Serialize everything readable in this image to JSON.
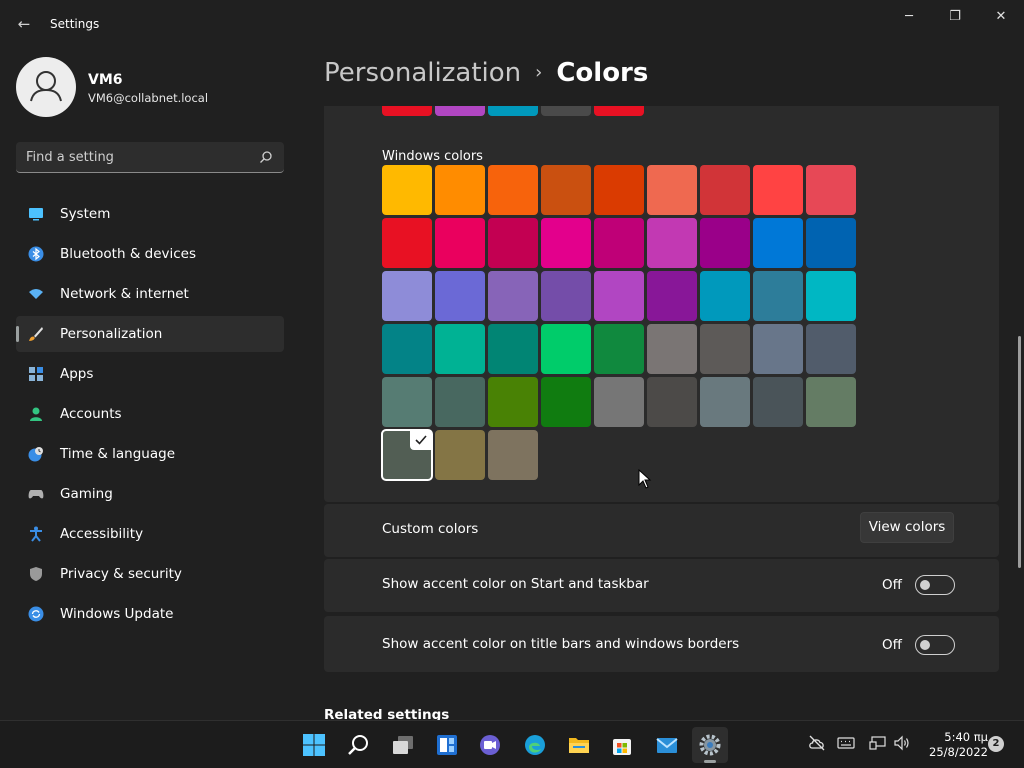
{
  "window": {
    "title": "Settings",
    "back_icon": "←",
    "minimize_icon": "─",
    "maximize_icon": "❐",
    "close_icon": "✕"
  },
  "profile": {
    "name": "VM6",
    "email": "VM6@collabnet.local"
  },
  "search": {
    "placeholder": "Find a setting"
  },
  "sidebar": {
    "items": [
      {
        "label": "System",
        "icon": "monitor-icon"
      },
      {
        "label": "Bluetooth & devices",
        "icon": "bluetooth-icon"
      },
      {
        "label": "Network & internet",
        "icon": "wifi-icon"
      },
      {
        "label": "Personalization",
        "icon": "brush-icon",
        "active": true
      },
      {
        "label": "Apps",
        "icon": "apps-icon"
      },
      {
        "label": "Accounts",
        "icon": "person-icon"
      },
      {
        "label": "Time & language",
        "icon": "clock-globe-icon"
      },
      {
        "label": "Gaming",
        "icon": "gamepad-icon"
      },
      {
        "label": "Accessibility",
        "icon": "accessibility-icon"
      },
      {
        "label": "Privacy & security",
        "icon": "shield-icon"
      },
      {
        "label": "Windows Update",
        "icon": "update-icon"
      }
    ]
  },
  "header": {
    "parent": "Personalization",
    "separator": "›",
    "current": "Colors"
  },
  "colors": {
    "recent": [
      "#e81123",
      "#b146c2",
      "#0099bc",
      "#4a4a4a",
      "#e81123"
    ],
    "windows_label": "Windows colors",
    "palette": [
      "#ffb900",
      "#ff8c00",
      "#f7630c",
      "#ca5010",
      "#da3b01",
      "#ef6950",
      "#d13438",
      "#ff4343",
      "#e74856",
      "#e81123",
      "#ea005e",
      "#c30052",
      "#e3008c",
      "#bf0077",
      "#c239b3",
      "#9a0089",
      "#0078d7",
      "#0063b1",
      "#8e8cd8",
      "#6b69d6",
      "#8764b8",
      "#744da9",
      "#b146c2",
      "#881798",
      "#0099bc",
      "#2d7d9a",
      "#00b7c3",
      "#038387",
      "#00b294",
      "#018574",
      "#00cc6a",
      "#10893e",
      "#7a7574",
      "#5d5a58",
      "#68768a",
      "#515c6b",
      "#567c73",
      "#486860",
      "#498205",
      "#107c10",
      "#767676",
      "#4c4a48",
      "#69797e",
      "#4a5459",
      "#647c64",
      "#525e54",
      "#847545",
      "#7e735f"
    ],
    "selected_index": 45
  },
  "custom_colors": {
    "label": "Custom colors",
    "button": "View colors"
  },
  "toggles": [
    {
      "label": "Show accent color on Start and taskbar",
      "state": "Off"
    },
    {
      "label": "Show accent color on title bars and windows borders",
      "state": "Off"
    }
  ],
  "related": {
    "label": "Related settings"
  },
  "taskbar": {
    "apps": [
      "start-icon",
      "search-icon",
      "task-view-icon",
      "widgets-icon",
      "chat-icon",
      "edge-icon",
      "file-explorer-icon",
      "store-icon",
      "mail-icon",
      "settings-icon"
    ],
    "active_app": "settings-icon"
  },
  "tray": {
    "time": "5:40 πμ",
    "date": "25/8/2022",
    "notifications": "2"
  }
}
